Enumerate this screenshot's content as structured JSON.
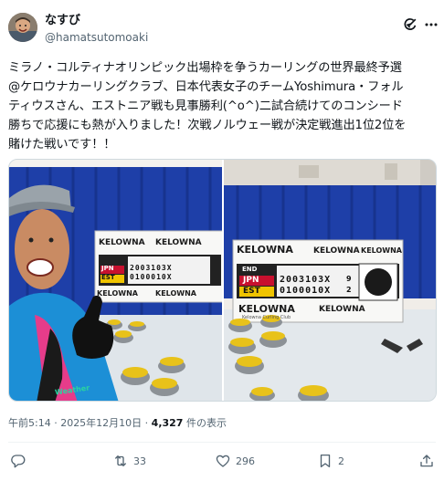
{
  "user": {
    "display_name": "なすび",
    "handle": "@hamatsutomoaki"
  },
  "tweet": {
    "lines": [
      "ミラノ・コルティナオリンピック出場枠を争うカーリングの世界最終予選",
      "@ケロウナカーリングクラブ、日本代表女子のチームYoshimura・フォル",
      "ティウスさん、エストニア戦も見事勝利(^o^)二試合続けてのコンシード",
      "勝ちで応援にも熱が入りました！次戦ノルウェー戦が決定戦進出1位2位を",
      "賭けた戦いです！！"
    ]
  },
  "media": {
    "scoreboard_brand": "KELOWNA",
    "scoreboard_sub": "Kelowna Curling Club",
    "row_end": "END",
    "team1": "JPN",
    "team2": "EST",
    "team1_scores": "2003103X",
    "team2_scores": "0100010X",
    "team1_total": "9",
    "team2_total": "2",
    "shirt_text": "Weather",
    "colors": {
      "curtain": "#1e3fa8",
      "wall": "#e9e6e0",
      "stone_handle": "#e8c21a",
      "jacket": "#1c8fd6"
    }
  },
  "meta": {
    "time": "午前5:14 · 2025年12月10日 · ",
    "views_count": "4,327",
    "views_label": " 件の表示"
  },
  "stats": {
    "reposts": "33",
    "likes": "296",
    "bookmarks": "2"
  },
  "icons": {
    "grok": "grok-icon",
    "more": "more-icon",
    "reply": "reply-icon",
    "repost": "repost-icon",
    "like": "heart-icon",
    "bookmark": "bookmark-icon",
    "share": "share-icon"
  }
}
